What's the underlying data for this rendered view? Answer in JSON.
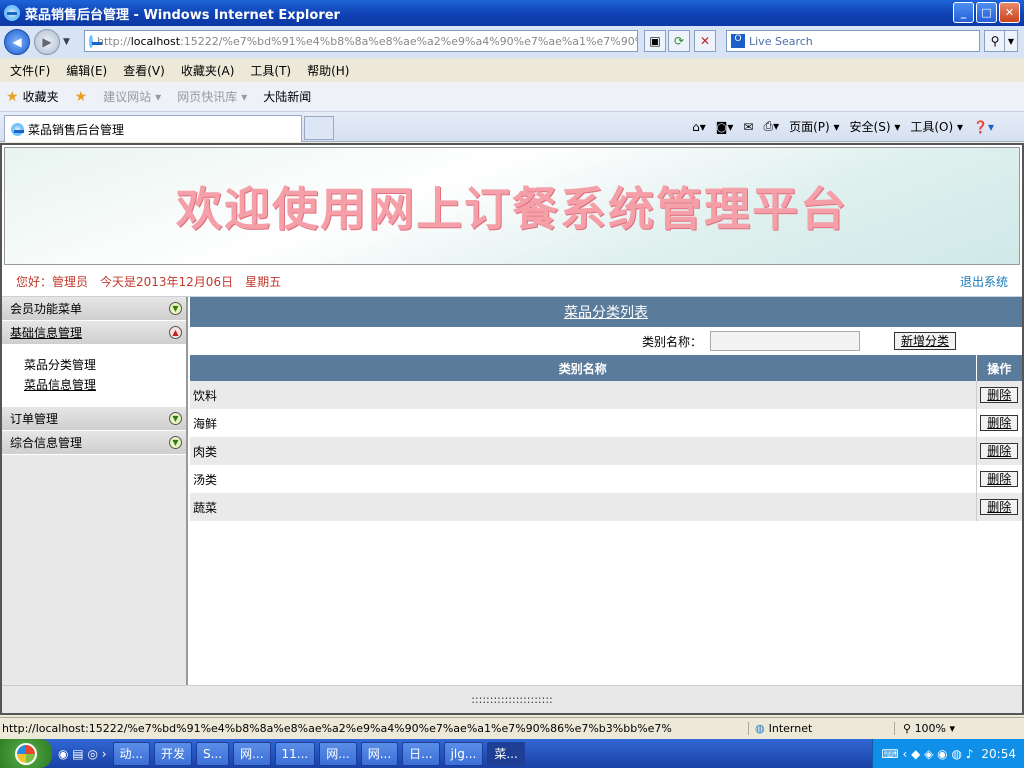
{
  "window": {
    "title": "菜品销售后台管理 - Windows Internet Explorer"
  },
  "address": {
    "url_prefix": "http://",
    "url_host": "localhost",
    "url_rest": ":15222/%e7%bd%91%e4%b8%8a%e8%ae%a2%e9%a4%90%e7%ae%a1%e7%90%",
    "search_placeholder": "Live Search"
  },
  "menu": [
    "文件(F)",
    "编辑(E)",
    "查看(V)",
    "收藏夹(A)",
    "工具(T)",
    "帮助(H)"
  ],
  "favorites": {
    "fav": "收藏夹",
    "suggest": "建议网站",
    "quick": "网页快讯库",
    "news": "大陆新闻"
  },
  "tab": {
    "label": "菜品销售后台管理"
  },
  "cmdbar": {
    "page": "页面(P)",
    "safety": "安全(S)",
    "tools": "工具(O)"
  },
  "banner": {
    "text": "欢迎使用网上订餐系统管理平台"
  },
  "greeting": {
    "text": "您好：管理员　今天是2013年12月06日　星期五",
    "logout": "退出系统"
  },
  "sidebar": {
    "member": "会员功能菜单",
    "basic": "基础信息管理",
    "sub1": "菜品分类管理",
    "sub2": "菜品信息管理",
    "order": "订单管理",
    "general": "综合信息管理"
  },
  "main": {
    "title": "菜品分类列表",
    "search_label": "类别名称：",
    "add_button": "新增分类",
    "col_name": "类别名称",
    "col_op": "操作",
    "rows": [
      "饮料",
      "海鲜",
      "肉类",
      "汤类",
      "蔬菜"
    ],
    "delete_label": "删除"
  },
  "footer_divider": "::::::::::::::::::::::",
  "status": {
    "url": "http://localhost:15222/%e7%bd%91%e4%b8%8a%e8%ae%a2%e9%a4%90%e7%ae%a1%e7%90%86%e7%b3%bb%e7%",
    "zone": "Internet",
    "zoom": "100%"
  },
  "taskbar": {
    "items": [
      "动...",
      "开发",
      "S...",
      "网...",
      "11...",
      "网...",
      "网...",
      "日...",
      "jlg...",
      "菜..."
    ],
    "clock": "20:54"
  }
}
